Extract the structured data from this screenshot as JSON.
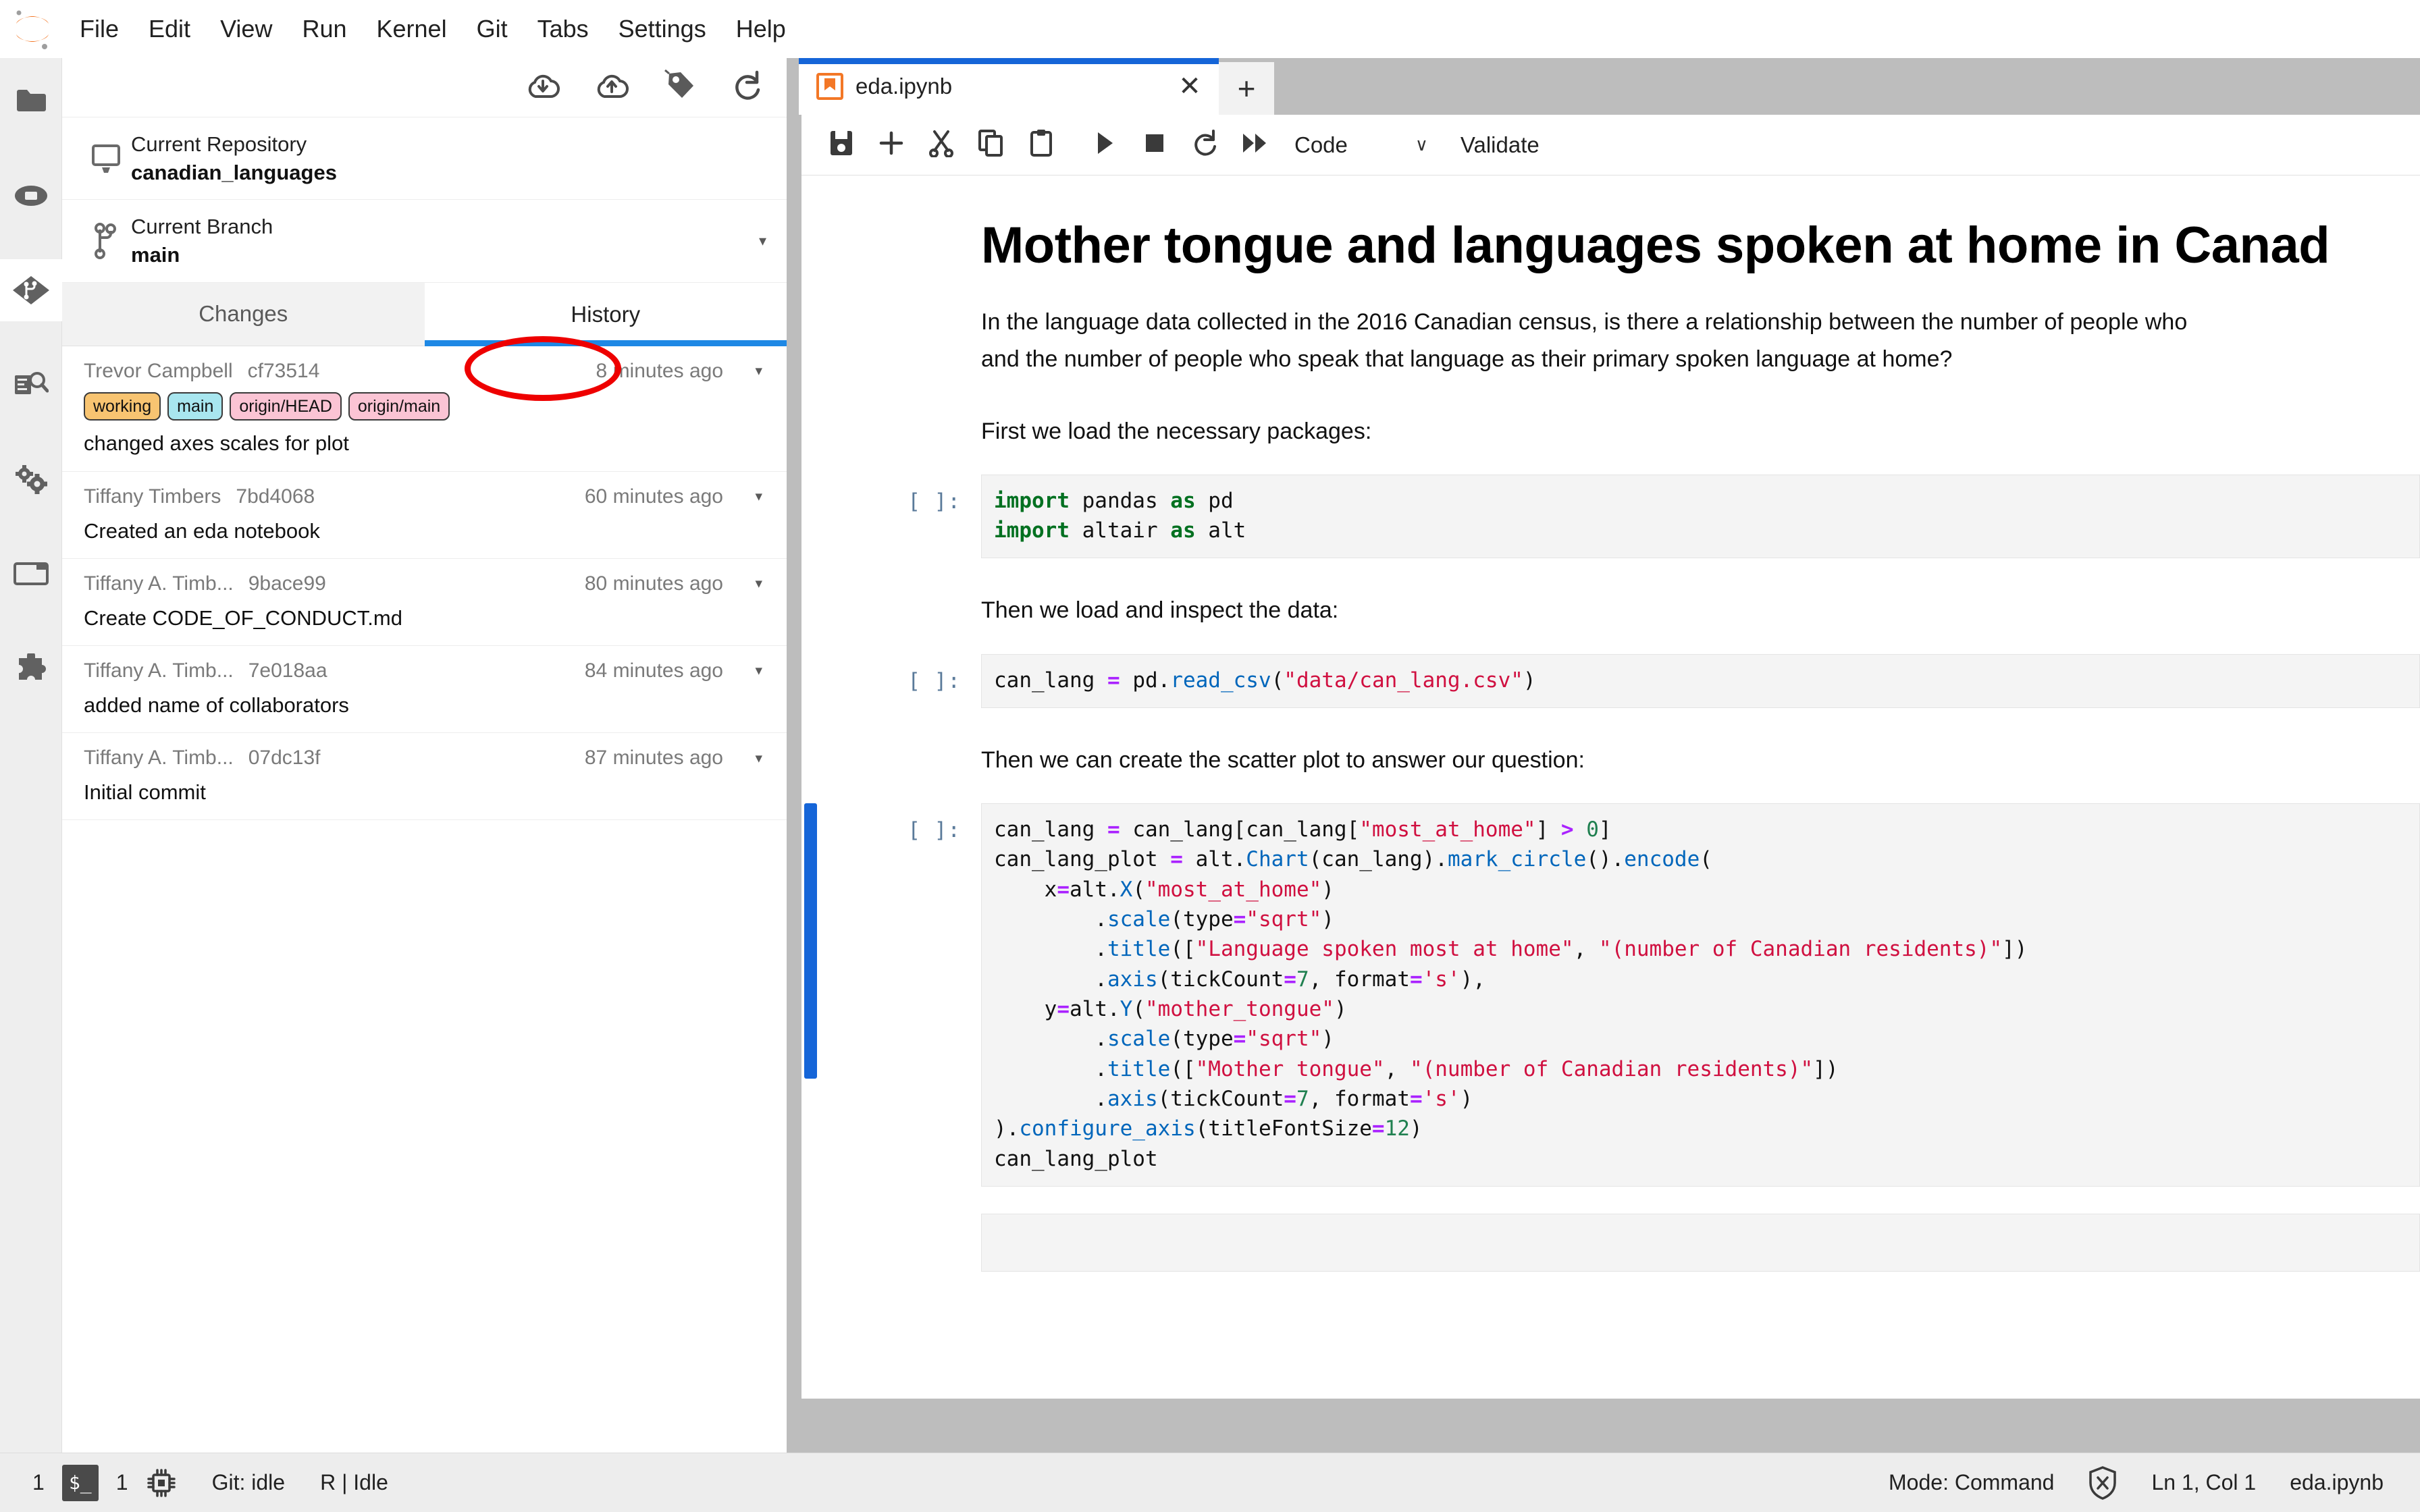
{
  "menubar": {
    "logo": "jupyter-logo",
    "items": [
      {
        "label": "File"
      },
      {
        "label": "Edit"
      },
      {
        "label": "View"
      },
      {
        "label": "Run"
      },
      {
        "label": "Kernel"
      },
      {
        "label": "Git"
      },
      {
        "label": "Tabs"
      },
      {
        "label": "Settings"
      },
      {
        "label": "Help"
      }
    ]
  },
  "activitybar": {
    "items": [
      {
        "icon": "folder-icon",
        "name": "file-browser",
        "active": false
      },
      {
        "icon": "running-terminals-icon",
        "name": "running-kernels",
        "active": false
      },
      {
        "icon": "git-branch-diamond-icon",
        "name": "git-panel",
        "active": true
      },
      {
        "icon": "property-inspector-icon",
        "name": "property-inspector",
        "active": false
      },
      {
        "icon": "gears-icon",
        "name": "extension-settings",
        "active": false
      },
      {
        "icon": "table-of-contents-icon",
        "name": "table-of-contents",
        "active": false
      },
      {
        "icon": "puzzle-piece-icon",
        "name": "extension-manager",
        "active": false
      }
    ]
  },
  "git": {
    "toolbar": [
      {
        "name": "pull-button",
        "icon": "cloud-download-icon"
      },
      {
        "name": "push-button",
        "icon": "cloud-upload-icon"
      },
      {
        "name": "tag-button",
        "icon": "tag-icon"
      },
      {
        "name": "refresh-button",
        "icon": "refresh-icon"
      }
    ],
    "repository": {
      "label": "Current Repository",
      "value": "canadian_languages",
      "icon": "desktop-icon"
    },
    "branch": {
      "label": "Current Branch",
      "value": "main",
      "icon": "branch-icon",
      "caret": "▾"
    },
    "tabs": [
      {
        "label": "Changes",
        "active": false
      },
      {
        "label": "History",
        "active": true
      }
    ],
    "annotation": {
      "shape": "ellipse",
      "color": "#ee0000",
      "target": "History"
    },
    "commits": [
      {
        "author": "Trevor Campbell",
        "hash": "cf73514",
        "date": "8 minutes ago",
        "message": "changed axes scales for plot",
        "badges": [
          {
            "label": "working",
            "bg": "#f8c471"
          },
          {
            "label": "main",
            "bg": "#a8e6ef"
          },
          {
            "label": "origin/HEAD",
            "bg": "#fbc4d4"
          },
          {
            "label": "origin/main",
            "bg": "#fbc4d4"
          }
        ]
      },
      {
        "author": "Tiffany Timbers",
        "hash": "7bd4068",
        "date": "60 minutes ago",
        "message": "Created an eda notebook",
        "badges": []
      },
      {
        "author": "Tiffany A. Timb...",
        "hash": "9bace99",
        "date": "80 minutes ago",
        "message": "Create CODE_OF_CONDUCT.md",
        "badges": []
      },
      {
        "author": "Tiffany A. Timb...",
        "hash": "7e018aa",
        "date": "84 minutes ago",
        "message": "added name of collaborators",
        "badges": []
      },
      {
        "author": "Tiffany A. Timb...",
        "hash": "07dc13f",
        "date": "87 minutes ago",
        "message": "Initial commit",
        "badges": []
      }
    ]
  },
  "notebook": {
    "tab": {
      "label": "eda.ipynb",
      "icon": "notebook-icon",
      "close": "✕"
    },
    "add_tab": "+",
    "toolbar": {
      "buttons": [
        {
          "name": "save-button",
          "icon": "save-icon"
        },
        {
          "name": "insert-cell-button",
          "icon": "plus-icon"
        },
        {
          "name": "cut-cell-button",
          "icon": "scissors-icon"
        },
        {
          "name": "copy-cell-button",
          "icon": "copy-icon"
        },
        {
          "name": "paste-cell-button",
          "icon": "clipboard-icon"
        },
        {
          "name": "run-cell-button",
          "icon": "play-icon"
        },
        {
          "name": "interrupt-kernel-button",
          "icon": "stop-square-icon"
        },
        {
          "name": "restart-kernel-button",
          "icon": "restart-icon"
        },
        {
          "name": "restart-run-all-button",
          "icon": "fast-forward-icon"
        }
      ],
      "cell_type": "Code",
      "cell_type_chevron": "∨",
      "validate": "Validate"
    },
    "title": "Mother tongue and languages spoken at home in Canad",
    "paragraphs": [
      {
        "lines": [
          "In the language data collected in the 2016 Canadian census, is there a relationship between the number of people who",
          "and the number of people who speak that language as their primary spoken language at home?"
        ]
      },
      {
        "lines": [
          "First we load the necessary packages:"
        ]
      },
      {
        "lines": [
          "Then we load and inspect the data:"
        ]
      },
      {
        "lines": [
          "Then we can create the scatter plot to answer our question:"
        ]
      }
    ],
    "cells": [
      {
        "prompt": "[ ]:",
        "active": false,
        "lines": [
          "import pandas as pd",
          "import altair as alt"
        ]
      },
      {
        "prompt": "[ ]:",
        "active": false,
        "lines": [
          "can_lang = pd.read_csv(\"data/can_lang.csv\")"
        ]
      },
      {
        "prompt": "[ ]:",
        "active": true,
        "lines": [
          "can_lang = can_lang[can_lang[\"most_at_home\"] > 0]",
          "can_lang_plot = alt.Chart(can_lang).mark_circle().encode(",
          "    x=alt.X(\"most_at_home\")",
          "        .scale(type=\"sqrt\")",
          "        .title([\"Language spoken most at home\", \"(number of Canadian residents)\"])",
          "        .axis(tickCount=7, format='s'),",
          "    y=alt.Y(\"mother_tongue\")",
          "        .scale(type=\"sqrt\")",
          "        .title([\"Mother tongue\", \"(number of Canadian residents)\"])",
          "        .axis(tickCount=7, format='s')",
          ").configure_axis(titleFontSize=12)",
          "can_lang_plot"
        ]
      },
      {
        "prompt": "",
        "active": false,
        "lines": [],
        "empty": true
      }
    ]
  },
  "statusbar": {
    "left": [
      {
        "type": "text",
        "value": "1",
        "name": "kernel-count"
      },
      {
        "type": "terminal-icon",
        "value": "$_",
        "name": "terminal-icon"
      },
      {
        "type": "text",
        "value": "1",
        "name": "terminal-count"
      },
      {
        "type": "cpu-icon",
        "value": "",
        "name": "kernel-chip-icon"
      },
      {
        "type": "text",
        "value": "Git: idle",
        "name": "git-status"
      },
      {
        "type": "text",
        "value": "R | Idle",
        "name": "kernel-status"
      }
    ],
    "right": [
      {
        "type": "text",
        "value": "Mode: Command",
        "name": "editor-mode"
      },
      {
        "type": "shield-icon",
        "value": "",
        "name": "trust-shield-icon"
      },
      {
        "type": "text",
        "value": "Ln 1, Col 1",
        "name": "cursor-position"
      },
      {
        "type": "text",
        "value": "eda.ipynb",
        "name": "active-file-name"
      }
    ]
  },
  "colors": {
    "accent_blue": "#1565d8",
    "tab_underline": "#1e88e5",
    "annotation_red": "#ee0000",
    "jupyter_orange": "#f37726",
    "dock_gray": "#bdbdbd",
    "statusbar_gray": "#ededed"
  }
}
